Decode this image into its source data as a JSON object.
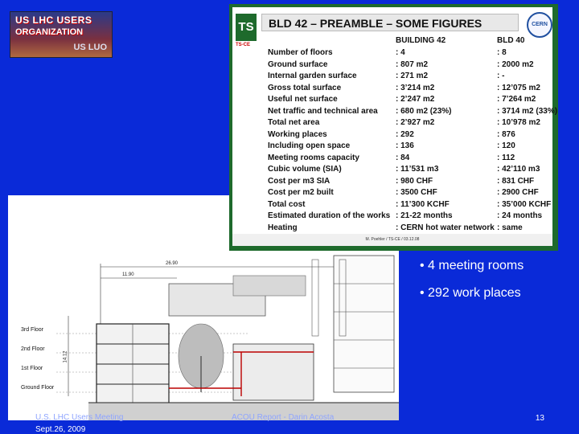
{
  "logo": {
    "line1": "US LHC USERS",
    "line2": "ORGANIZATION",
    "line3": "US LUO"
  },
  "preamble": {
    "ts_logo": "TS",
    "ts_sub": "TS-CE",
    "title": "BLD 42 – PREAMBLE – SOME FIGURES",
    "cern": "CERN",
    "col_b42": "BUILDING 42",
    "col_b40": "BLD 40",
    "rows": [
      {
        "label": "Number of floors",
        "b42": ": 4",
        "b40": ": 8"
      },
      {
        "label": "Ground surface",
        "b42": ": 807 m2",
        "b40": ": 2000 m2"
      },
      {
        "label": "Internal garden surface",
        "b42": ": 271 m2",
        "b40": ": -"
      },
      {
        "label": "Gross total surface",
        "b42": ": 3’214 m2",
        "b40": ": 12’075 m2"
      },
      {
        "label": "Useful net surface",
        "b42": ": 2’247 m2",
        "b40": ": 7’264 m2"
      },
      {
        "label": "Net traffic and technical area",
        "b42": ": 680 m2 (23%)",
        "b40": ": 3714 m2 (33%)"
      },
      {
        "label": "Total net area",
        "b42": ": 2’927 m2",
        "b40": ": 10’978 m2"
      },
      {
        "label": "Working places",
        "b42": ": 292",
        "b40": ": 876"
      },
      {
        "label": "Including open space",
        "b42": ": 136",
        "b40": ": 120"
      },
      {
        "label": "Meeting rooms capacity",
        "b42": ": 84",
        "b40": ": 112"
      },
      {
        "label": "Cubic volume (SIA)",
        "b42": ": 11’531 m3",
        "b40": ": 42’110 m3"
      },
      {
        "label": "Cost per m3 SIA",
        "b42": ": 980 CHF",
        "b40": ": 831 CHF"
      },
      {
        "label": "Cost per m2 built",
        "b42": ": 3500 CHF",
        "b40": ": 2900 CHF"
      },
      {
        "label": "Total cost",
        "b42": ": 11’300 KCHF",
        "b40": ": 35’000 KCHF"
      },
      {
        "label": "Estimated duration of the works",
        "b42": ": 21-22 months",
        "b40": ": 24 months"
      },
      {
        "label": "Heating",
        "b42": ": CERN hot water network",
        "b40": ": same"
      }
    ],
    "footer": "M. Poehler / TS-CE / 03.12.08"
  },
  "drawing": {
    "dim_top": "26.90",
    "dim_mid": "11.90",
    "dim_side": "14.12",
    "floors": [
      "3rd Floor",
      "2nd Floor",
      "1st Floor",
      "Ground Floor"
    ]
  },
  "bullets": [
    "4 meeting rooms",
    "292 work places"
  ],
  "footer": {
    "left_line1": "U.S. LHC Users Meeting",
    "left_line2": "Sept.26, 2009",
    "center": "ACOU Report - Darin Acosta",
    "slide_number": "13"
  },
  "colors": {
    "background": "#0a2ad8",
    "panel_frame": "#1e6a2c",
    "bullet_text": "#ffffff"
  }
}
